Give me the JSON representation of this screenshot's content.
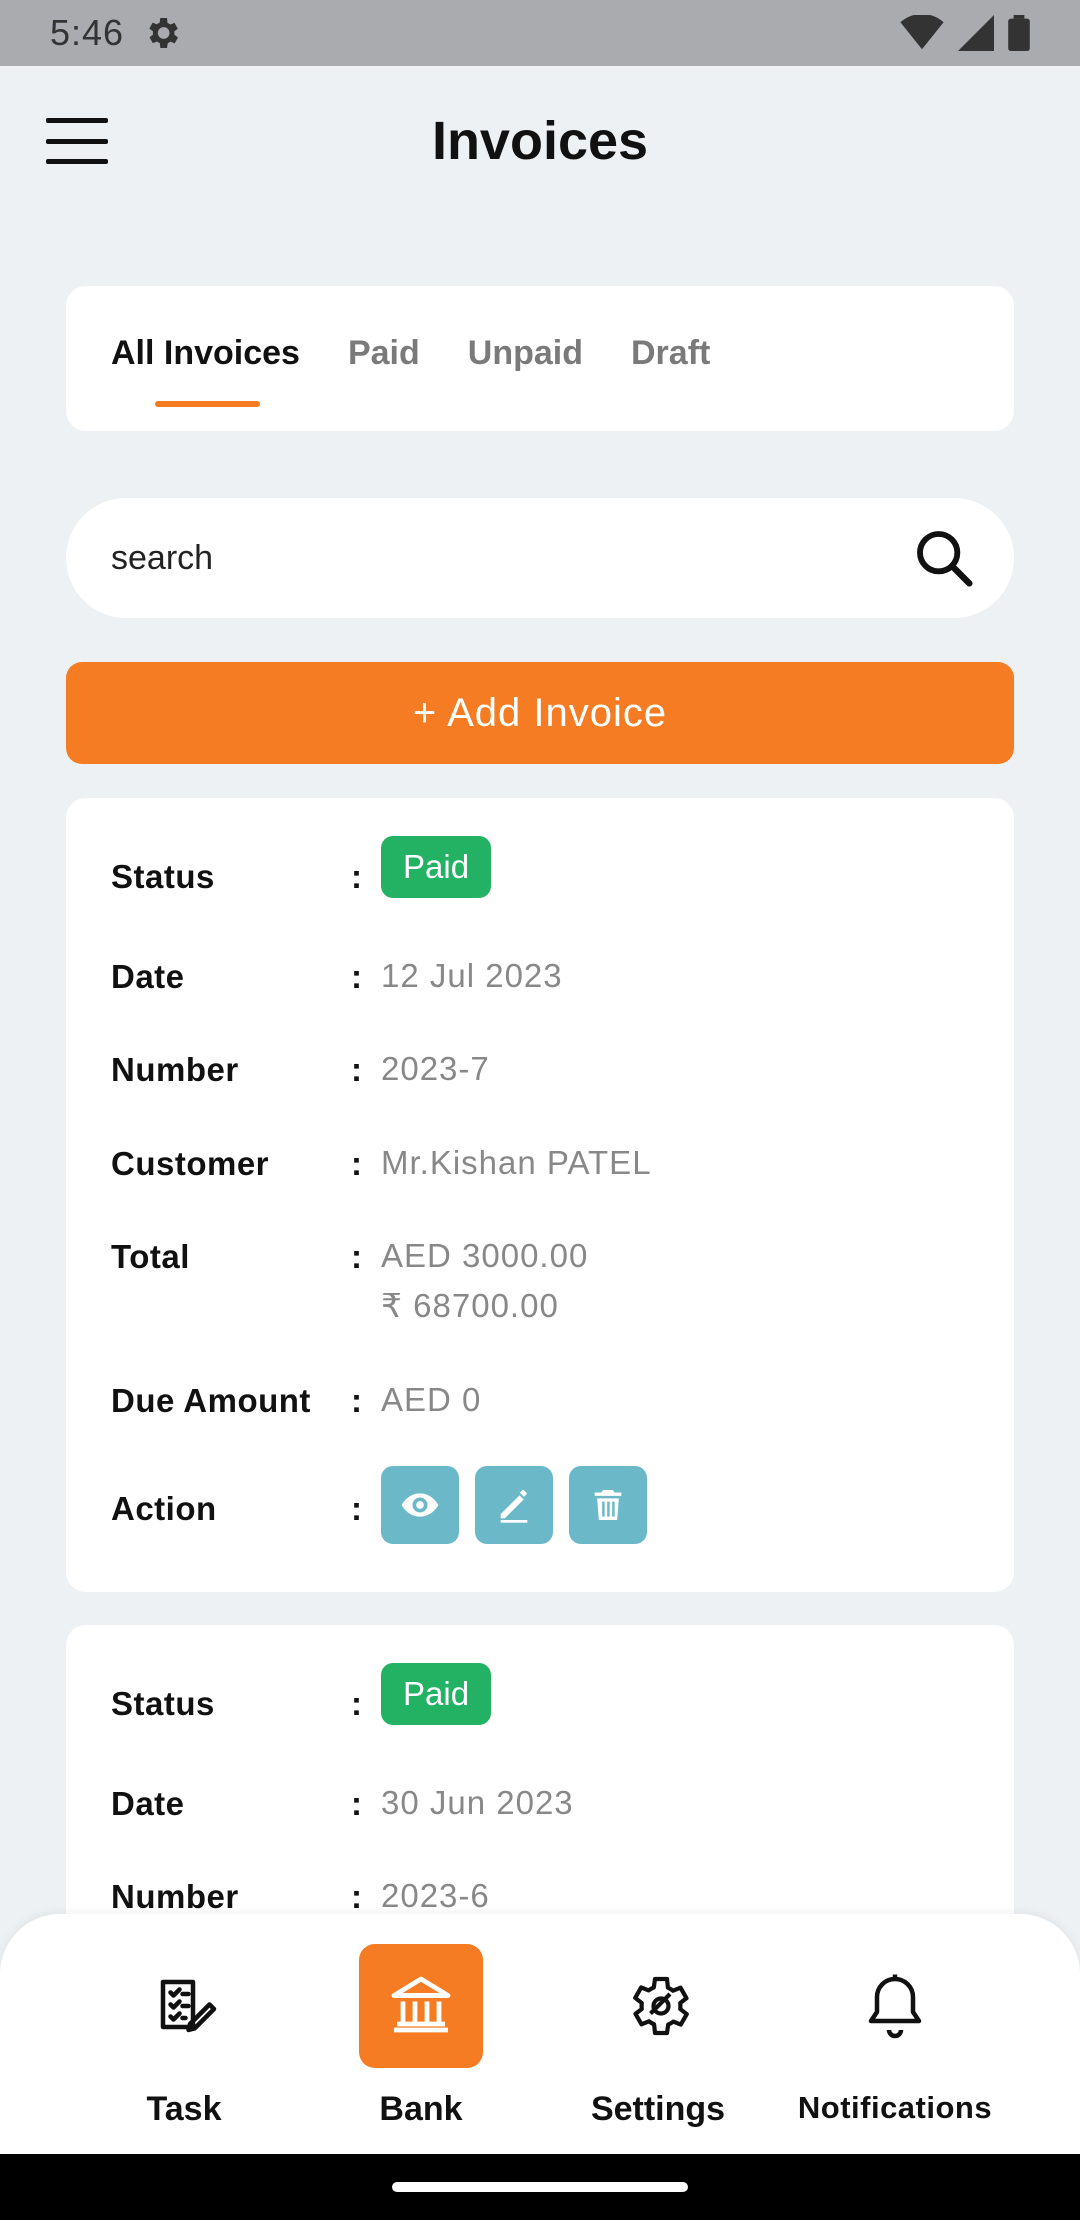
{
  "status_bar": {
    "time": "5:46"
  },
  "header": {
    "title": "Invoices"
  },
  "tabs": [
    {
      "label": "All Invoices",
      "active": true
    },
    {
      "label": "Paid",
      "active": false
    },
    {
      "label": "Unpaid",
      "active": false
    },
    {
      "label": "Draft",
      "active": false
    }
  ],
  "search": {
    "placeholder": "search"
  },
  "add_button": {
    "label": "+ Add Invoice"
  },
  "field_labels": {
    "status": "Status",
    "date": "Date",
    "number": "Number",
    "customer": "Customer",
    "total": "Total",
    "due_amount": "Due Amount",
    "action": "Action",
    "colon": ":"
  },
  "invoices": [
    {
      "status": "Paid",
      "date": "12 Jul 2023",
      "number": "2023-7",
      "customer": "Mr.Kishan PATEL",
      "total_aed": "AED 3000.00",
      "total_inr": "₹ 68700.00",
      "due_amount": "AED 0"
    },
    {
      "status": "Paid",
      "date": "30 Jun 2023",
      "number": "2023-6"
    }
  ],
  "bottom_nav": [
    {
      "label": "Task",
      "icon": "task-list-icon",
      "active": false
    },
    {
      "label": "Bank",
      "icon": "bank-icon",
      "active": true
    },
    {
      "label": "Settings",
      "icon": "settings-gear-icon",
      "active": false
    },
    {
      "label": "Notifications",
      "icon": "bell-icon",
      "active": false
    }
  ],
  "colors": {
    "accent": "#f57c22",
    "paid": "#23b264",
    "action": "#6bb9c8",
    "background": "#eef1f4"
  }
}
